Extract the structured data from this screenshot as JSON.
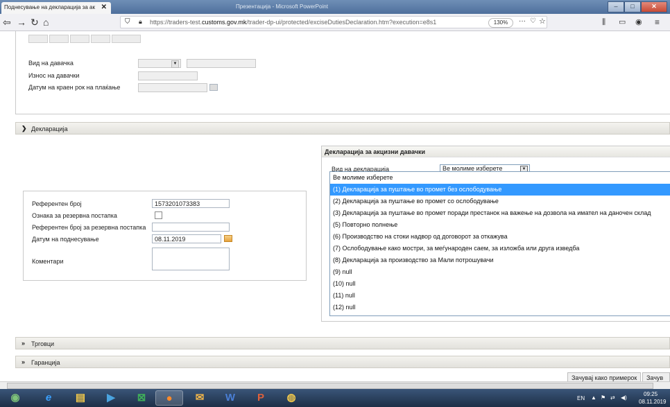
{
  "browser": {
    "tab_title": "Поднесување на декларација за ак",
    "tab_close": "✕",
    "window_title": "Презентација - Microsoft PowerPoint",
    "url_prefix": "https://traders-test.",
    "url_domain": "customs.gov.mk",
    "url_path": "/trader-dp-ui/protected/exciseDutiesDeclaration.htm?execution=e8s1",
    "zoom": "130%",
    "more": "···"
  },
  "duty_form": {
    "type_label": "Вид на давачка",
    "amount_label": "Износ на давачки",
    "deadline_label": "Датум на краен рок на плаќање"
  },
  "sections": {
    "declaration": "Декларација",
    "traders": "Трговци",
    "guarantee": "Гаранција"
  },
  "left_form": {
    "ref_label": "Референтен број",
    "ref_value": "1573201073383",
    "backup_flag_label": "Ознака за резервна постапка",
    "backup_ref_label": "Референтен број за резервна постапка",
    "submit_date_label": "Датум на поднесување",
    "submit_date_value": "08.11.2019",
    "comments_label": "Коментари"
  },
  "excise_panel": {
    "title": "Декларација за акцизни давачки",
    "type_label": "Вид на декларација",
    "select_value": "Ве молиме изберете",
    "partial_label": "(I"
  },
  "dropdown_options": [
    "Ве молиме изберете",
    "(1) Декларација за пуштање во промет без ослободување",
    "(2) Декларација за пуштање во промет со ослободување",
    "(3) Декларација за пуштање во промет поради престанок на важење на дозвола на имател на даночен склад",
    "(5) Повторно полнење",
    "(6) Производство на стоки надвор од договорот за откажува",
    "(7) Ослободување како мостри, за меѓународен саем, за изложба или друга изведба",
    "(8) Декларација за производство за Мали потрошувачи",
    "(9) null",
    "(10) null",
    "(11) null",
    "(12) null"
  ],
  "selected_option_index": 1,
  "buttons": {
    "save_template": "Зачувај како примерок",
    "save": "Зачув"
  },
  "taskbar": {
    "lang": "EN",
    "time": "09:25",
    "date": "08.11.2019"
  },
  "colors": {
    "selection": "#3399ff",
    "taskbar": "#1d2f47",
    "section_header": "#e8e7e2"
  }
}
